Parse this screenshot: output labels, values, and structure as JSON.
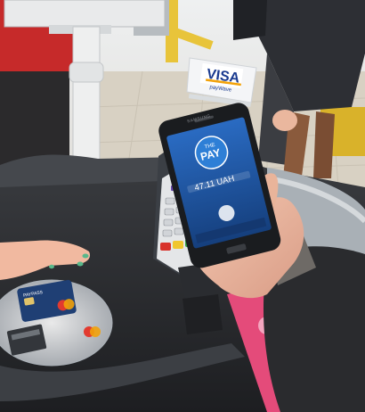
{
  "scene": {
    "visa_sign": {
      "brand": "VISA",
      "tagline": "payWave",
      "brand_color": "#1a3a8f",
      "accent_color": "#f2a20a"
    },
    "phone": {
      "app_badge_top": "THE",
      "app_badge_main": "PAY",
      "amount_text": "47.11 UAH",
      "screen_color": "#1e5aa8",
      "brand_label": "SAMSUNG"
    },
    "card_on_counter": {
      "brand": "PAYPASS"
    },
    "colors": {
      "counter": "#2a2c2f",
      "terminal": "#3a3d42",
      "visa_sign_bg": "#f4f5f7",
      "floor": "#d9d2c4",
      "poster": "#e44b7a"
    }
  }
}
